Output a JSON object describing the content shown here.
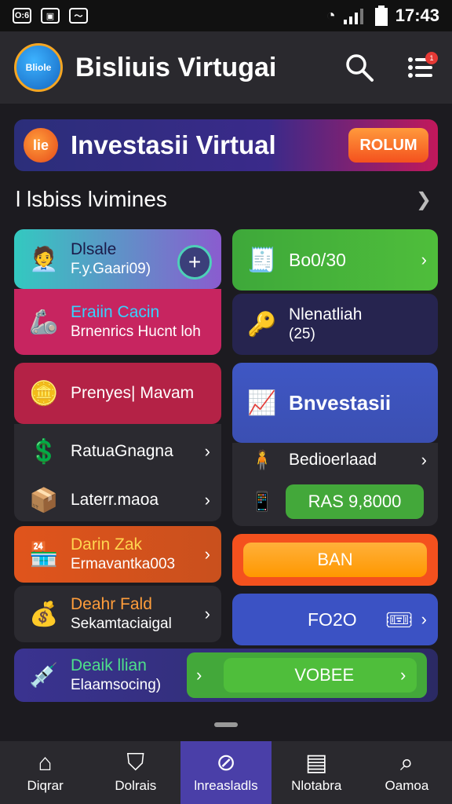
{
  "status": {
    "time": "17:43",
    "left_icons": [
      "O:6",
      "image",
      "health"
    ]
  },
  "appbar": {
    "title": "Bisliuis Virtugai",
    "logo_text": "Bliole",
    "notif_count": "1"
  },
  "banner": {
    "logo_text": "lie",
    "title": "Investasii Virtual",
    "button": "ROLUM"
  },
  "section": {
    "title": "l lsbiss lvimines"
  },
  "cards": {
    "c1": {
      "t1": "Dlsale",
      "t2": "F.y.Gaari09)"
    },
    "c2": {
      "t1": "Eraiin Cacin",
      "t2": "Brnenrics Hucnt loh"
    },
    "c3": {
      "t1": "Bo0/30"
    },
    "c4": {
      "t1": "Nlenatliah",
      "t2": "(25)"
    },
    "c5": {
      "t1": "Prenyes| Mavam"
    },
    "c6": {
      "t1": "RatuaGnagna"
    },
    "c7": {
      "t1": "Laterr.maoa"
    },
    "c8": {
      "t1": "Bnvestasii"
    },
    "c9": {
      "t1": "Bedioerlaad"
    },
    "c10": {
      "t1": "RAS 9,8000"
    },
    "c11": {
      "t1": "Darin Zak",
      "t2": "Ermavantka003"
    },
    "c12": {
      "t1": "BAN"
    },
    "c13": {
      "t1": "Deahr Fald",
      "t2": "Sekamtaciaigal"
    },
    "c14": {
      "t1": "FO2O"
    },
    "c15": {
      "t1": "Deaik llian",
      "t2": "Elaamsocing)"
    },
    "c16": {
      "t1": "VOBEE"
    }
  },
  "nav": [
    {
      "label": "Diqrar",
      "icon": "home-icon"
    },
    {
      "label": "Dolrais",
      "icon": "shield-icon"
    },
    {
      "label": "lnreasladls",
      "icon": "rocket-icon"
    },
    {
      "label": "Nlotabra",
      "icon": "chat-icon"
    },
    {
      "label": "Oamoa",
      "icon": "search-icon"
    }
  ],
  "colors": {
    "accent": "#4a3fa8",
    "green": "#43a83a",
    "orange": "#f4511e",
    "blue": "#3f51b5"
  }
}
